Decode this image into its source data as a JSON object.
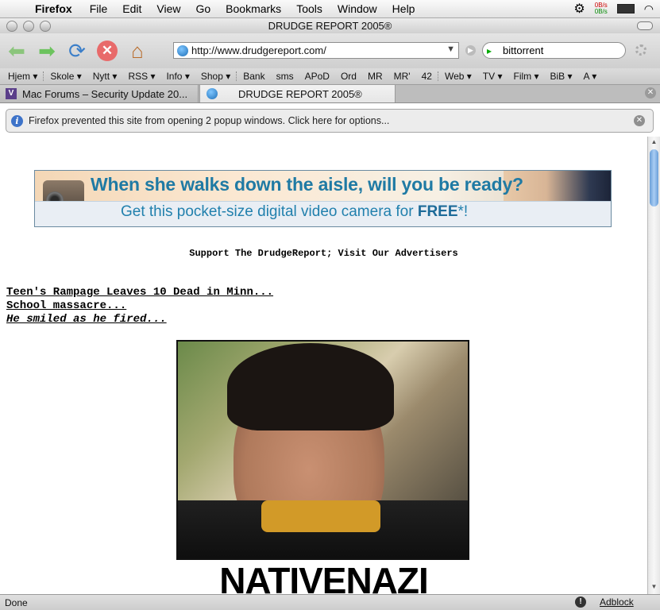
{
  "menubar": {
    "app": "Firefox",
    "items": [
      "File",
      "Edit",
      "View",
      "Go",
      "Bookmarks",
      "Tools",
      "Window",
      "Help"
    ],
    "net_out": "0B/s",
    "net_in": "0B/s"
  },
  "window": {
    "title": "DRUDGE REPORT 2005®"
  },
  "navigation": {
    "url": "http://www.drudgereport.com/",
    "search_value": "bittorrent"
  },
  "bookmarks": [
    "Hjem ▾",
    "Skole ▾",
    "Nytt ▾",
    "RSS ▾",
    "Info ▾",
    "Shop ▾",
    "Bank",
    "sms",
    "APoD",
    "Ord",
    "MR",
    "MR'",
    "42",
    "Web ▾",
    "TV ▾",
    "Film ▾",
    "BiB ▾",
    "A ▾"
  ],
  "tabs": [
    {
      "label": "Mac Forums – Security Update 20...",
      "active": false
    },
    {
      "label": "DRUDGE REPORT 2005®",
      "active": true
    }
  ],
  "notification": {
    "text": "Firefox prevented this site from opening 2 popup windows. Click here for options..."
  },
  "banner": {
    "line1": "When she walks down the aisle, will you be ready?",
    "line2_prefix": "Get this pocket-size digital video camera for ",
    "line2_bold": "FREE",
    "line2_suffix": "*!"
  },
  "content": {
    "support": "Support The DrudgeReport; Visit Our Advertisers",
    "headlines": [
      "Teen's Rampage Leaves 10 Dead in Minn...",
      "School massacre...",
      "He smiled as he fired..."
    ],
    "caption": "NATIVENAZI"
  },
  "status": {
    "text": "Done",
    "adblock": "Adblock"
  }
}
